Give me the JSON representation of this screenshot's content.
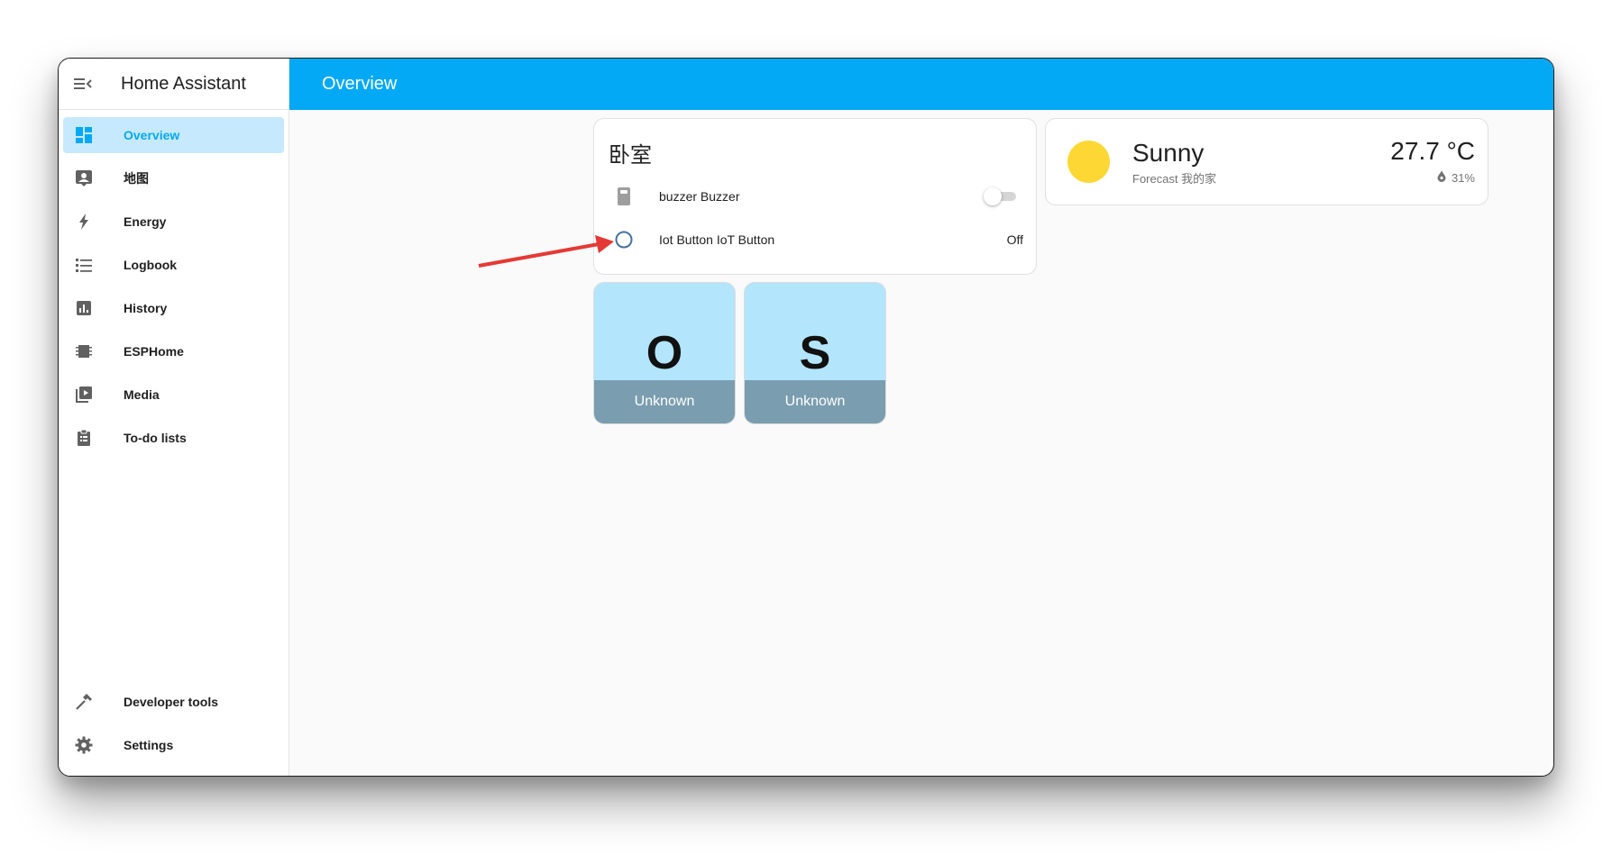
{
  "app": {
    "title": "Home Assistant"
  },
  "header": {
    "title": "Overview"
  },
  "sidebar": {
    "items": [
      {
        "label": "Overview",
        "icon": "dashboard-icon",
        "active": true
      },
      {
        "label": "地图",
        "icon": "map-account-icon"
      },
      {
        "label": "Energy",
        "icon": "lightning-bolt-icon"
      },
      {
        "label": "Logbook",
        "icon": "format-list-bulleted-icon"
      },
      {
        "label": "History",
        "icon": "chart-box-icon"
      },
      {
        "label": "ESPHome",
        "icon": "chip-icon"
      },
      {
        "label": "Media",
        "icon": "play-box-multiple-icon"
      },
      {
        "label": "To-do lists",
        "icon": "clipboard-list-icon"
      }
    ],
    "bottom_items": [
      {
        "label": "Developer tools",
        "icon": "hammer-icon"
      },
      {
        "label": "Settings",
        "icon": "cog-icon"
      }
    ]
  },
  "room_card": {
    "title": "卧室",
    "entities": [
      {
        "name": "buzzer Buzzer",
        "icon": "buzzer-icon",
        "state": "off"
      },
      {
        "name": "Iot Button IoT Button",
        "icon": "circle-outline-icon",
        "state": "Off"
      }
    ]
  },
  "weather_card": {
    "condition": "Sunny",
    "forecast": "Forecast 我的家",
    "temperature": "27.7 °C",
    "humidity": "31%"
  },
  "tiles": [
    {
      "letter": "O",
      "state": "Unknown"
    },
    {
      "letter": "S",
      "state": "Unknown"
    }
  ],
  "colors": {
    "primary": "#03a9f4",
    "active_nav_bg": "#c7e9fd",
    "tile_bg": "#b3e5fc",
    "tile_footer": "#7a9db0",
    "annotation_arrow": "#e53935",
    "sun": "#fdd835"
  }
}
